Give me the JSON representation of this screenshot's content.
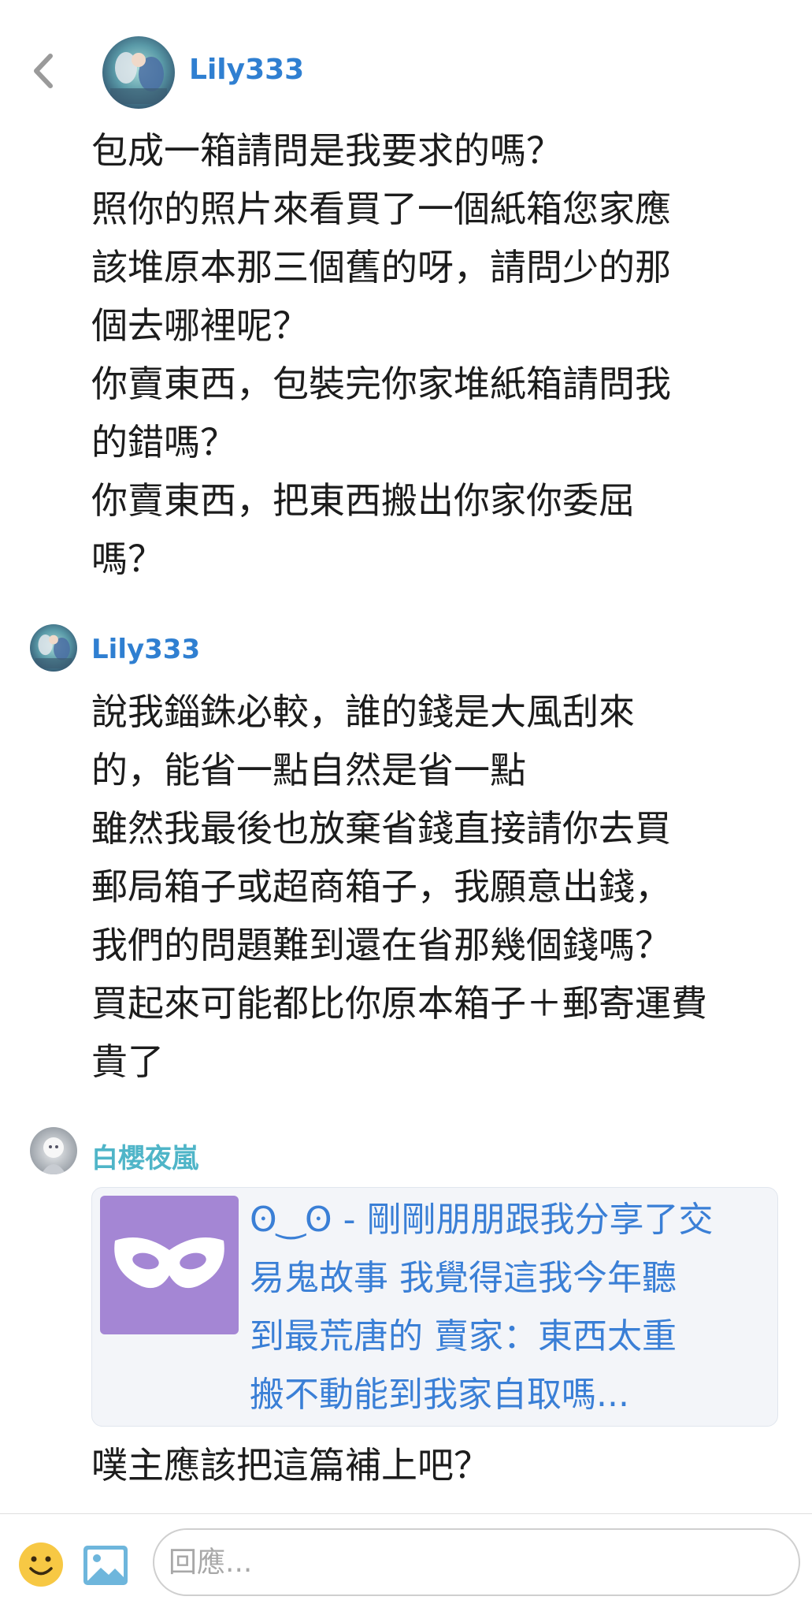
{
  "header": {
    "back_icon": "chevron-left-icon",
    "username": "Lily333"
  },
  "messages": [
    {
      "author": "Lily333",
      "text": "包成一箱請問是我要求的嗎？\n照你的照片來看買了一個紙箱您家應\n該堆原本那三個舊的呀，請問少的那\n個去哪裡呢？\n你賣東西，包裝完你家堆紙箱請問我\n的錯嗎？\n你賣東西，把東西搬出你家你委屈\n嗎？"
    },
    {
      "author": "Lily333",
      "text": "說我錙銖必較，誰的錢是大風刮來\n的，能省一點自然是省一點\n雖然我最後也放棄省錢直接請你去買\n郵局箱子或超商箱子，我願意出錢，\n我們的問題難到還在省那幾個錢嗎？\n買起來可能都比你原本箱子＋郵寄運費\n貴了"
    },
    {
      "author": "白櫻夜嵐",
      "link_preview": {
        "thumbnail_icon": "mask-icon",
        "text": "ʘ‿ʘ - 剛剛朋朋跟我分享了交\n易鬼故事 我覺得這我今年聽\n到最荒唐的 賣家：東西太重\n搬不動能到我家自取嗎..."
      },
      "text": "噗主應該把這篇補上吧？"
    }
  ],
  "composer": {
    "emoji_icon": "smiley-icon",
    "image_icon": "image-icon",
    "placeholder": "回應..."
  },
  "colors": {
    "username_blue": "#2f7fd1",
    "username_cyan": "#4fb5c8",
    "link_blue": "#3a7fd6",
    "thumb_purple": "#a486d4",
    "emoji_yellow": "#f7c844",
    "image_icon_blue": "#6eb6dc"
  }
}
